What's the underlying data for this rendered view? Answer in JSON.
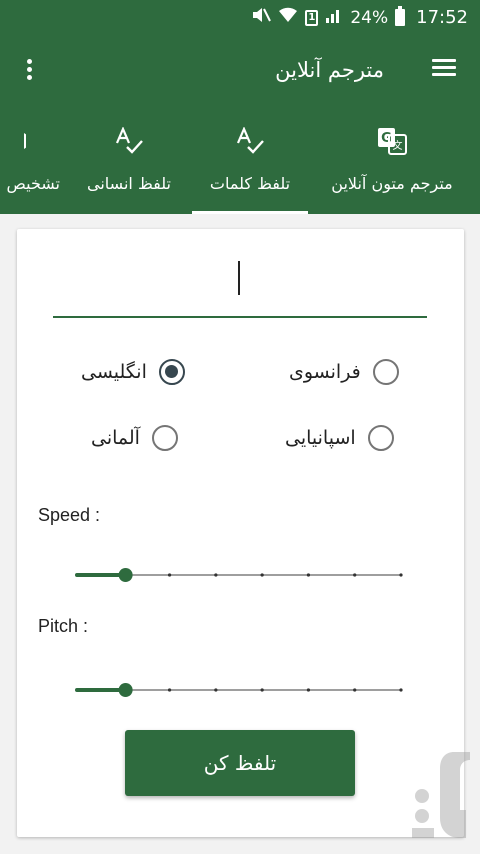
{
  "status_bar": {
    "battery": "24%",
    "time": "17:52",
    "sim_indicator": "1",
    "icons": [
      "mute-icon",
      "wifi-icon",
      "sim-icon",
      "signal-icon",
      "battery-icon"
    ]
  },
  "app_bar": {
    "title": "مترجم آنلاین",
    "menu_icon": "hamburger-menu-icon",
    "overflow_icon": "more-vert-icon"
  },
  "tabs": [
    {
      "label": "مترجم متون آنلاین",
      "icon": "google-translate-icon",
      "active": false
    },
    {
      "label": "تلفظ کلمات",
      "icon": "spellcheck-icon",
      "active": true
    },
    {
      "label": "تلفظ انسانی",
      "icon": "spellcheck-icon",
      "active": false
    },
    {
      "label": "تشخیص",
      "icon": "voice-icon",
      "active": false
    }
  ],
  "form": {
    "text_value": "",
    "languages": [
      {
        "label": "انگلیسی",
        "checked": true
      },
      {
        "label": "فرانسوی",
        "checked": false
      },
      {
        "label": "آلمانی",
        "checked": false
      },
      {
        "label": "اسپانیایی",
        "checked": false
      }
    ],
    "speed": {
      "label": "Speed :",
      "level": 0.15,
      "steps": 8
    },
    "pitch": {
      "label": "Pitch :",
      "level": 0.15,
      "steps": 8
    },
    "button_label": "تلفظ کن"
  },
  "colors": {
    "primary": "#2e6b3e",
    "radio_checked": "#37474f",
    "radio_unchecked": "#757575"
  },
  "watermark_icon": "store-logo-watermark"
}
